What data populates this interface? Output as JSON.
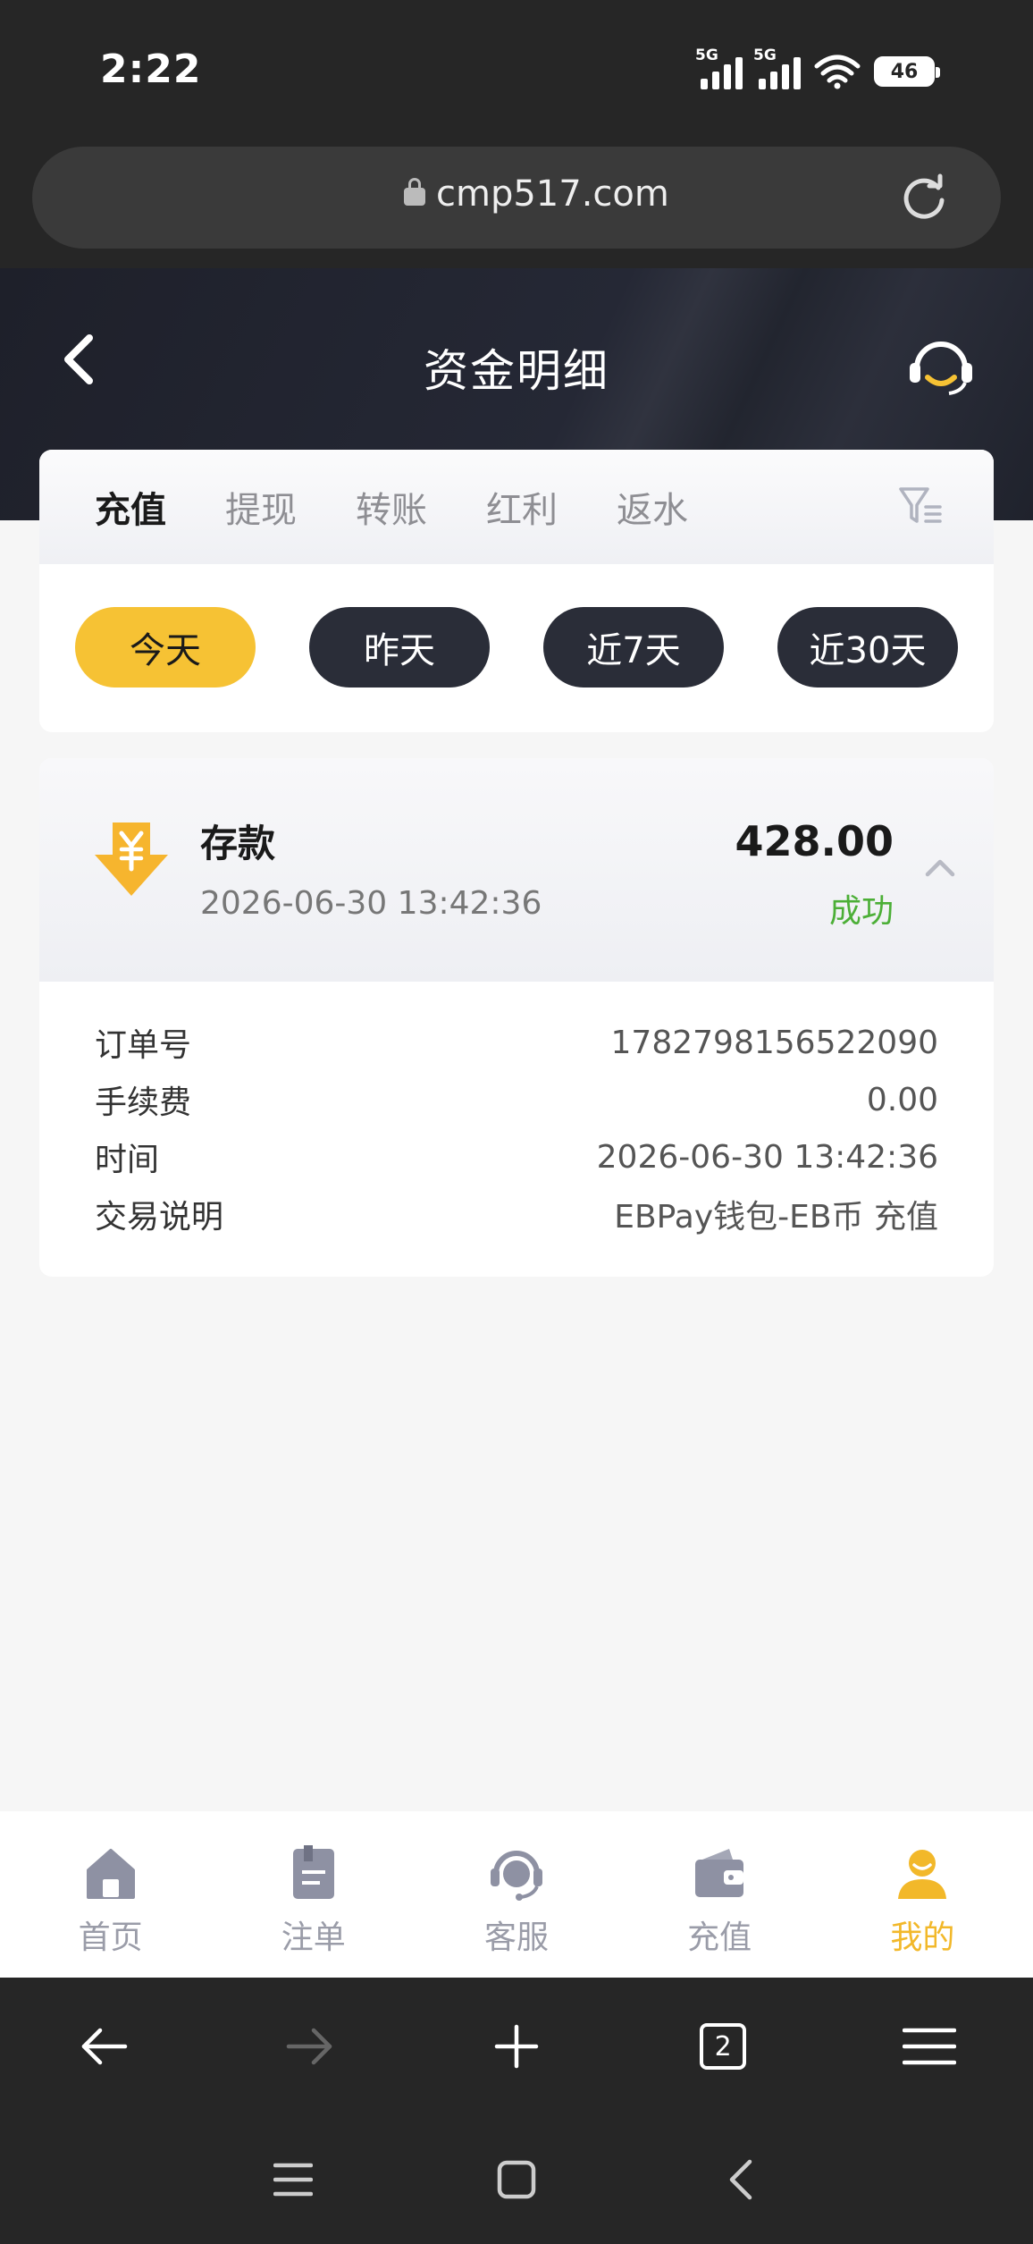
{
  "status_bar": {
    "time": "2:22",
    "network_1": "5G",
    "network_2": "5G",
    "battery": "46"
  },
  "browser": {
    "url": "cmp517.com",
    "tab_count": "2"
  },
  "header": {
    "title": "资金明细"
  },
  "tabs": [
    {
      "label": "充值",
      "active": true
    },
    {
      "label": "提现",
      "active": false
    },
    {
      "label": "转账",
      "active": false
    },
    {
      "label": "红利",
      "active": false
    },
    {
      "label": "返水",
      "active": false
    }
  ],
  "date_filters": [
    {
      "label": "今天",
      "active": true
    },
    {
      "label": "昨天",
      "active": false
    },
    {
      "label": "近7天",
      "active": false
    },
    {
      "label": "近30天",
      "active": false
    }
  ],
  "record": {
    "type": "存款",
    "datetime": "2026-06-30 13:42:36",
    "amount": "428.00",
    "status": "成功",
    "details": [
      {
        "label": "订单号",
        "value": "1782798156522090"
      },
      {
        "label": "手续费",
        "value": "0.00"
      },
      {
        "label": "时间",
        "value": "2026-06-30 13:42:36"
      },
      {
        "label": "交易说明",
        "value": "EBPay钱包-EB币 充值"
      }
    ]
  },
  "bottom_nav": [
    {
      "label": "首页",
      "icon": "home-icon",
      "active": false
    },
    {
      "label": "注单",
      "icon": "orders-icon",
      "active": false
    },
    {
      "label": "客服",
      "icon": "support-icon",
      "active": false
    },
    {
      "label": "充值",
      "icon": "wallet-icon",
      "active": false
    },
    {
      "label": "我的",
      "icon": "profile-icon",
      "active": true
    }
  ],
  "colors": {
    "accent": "#f6c234",
    "success": "#4caf37",
    "dark_button": "#2a2d38",
    "nav_inactive": "#9a9ca8",
    "nav_active": "#f2b82a"
  }
}
